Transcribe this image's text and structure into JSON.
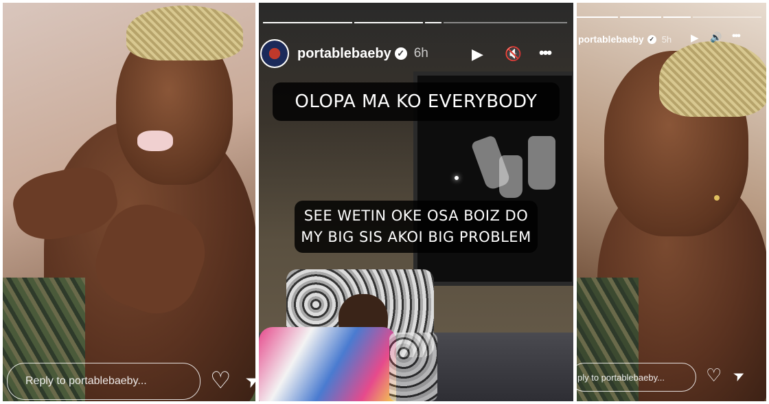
{
  "panels": [
    {
      "id": "left",
      "reply_placeholder": "Reply to portablebaeby...",
      "icons": [
        "heart-icon",
        "send-icon"
      ]
    },
    {
      "id": "center",
      "username": "portablebaeby",
      "timestamp": "6h",
      "caption_top": "OLOPA MA KO EVERYBODY",
      "caption_bottom_line1": "SEE WETIN OKE OSA BOIZ DO",
      "caption_bottom_line2": "MY BIG SIS AKOI BIG PROBLEM",
      "controls": [
        "play-icon",
        "mute-icon",
        "more-icon"
      ]
    },
    {
      "id": "right",
      "username": "portablebaeby",
      "timestamp": "5h",
      "reply_placeholder": "ply to portablebaeby...",
      "controls": [
        "play-icon",
        "volume-icon",
        "more-icon"
      ],
      "icons": [
        "heart-icon",
        "send-icon"
      ]
    }
  ],
  "glyphs": {
    "verified": "✓",
    "play": "▶",
    "mute": "🔇",
    "volume": "🔊",
    "more": "•••",
    "heart": "♡",
    "send": "➤"
  },
  "colors": {
    "caption_bg": "#000000",
    "caption_text": "#ffffff",
    "ui_text": "#ffffff"
  }
}
